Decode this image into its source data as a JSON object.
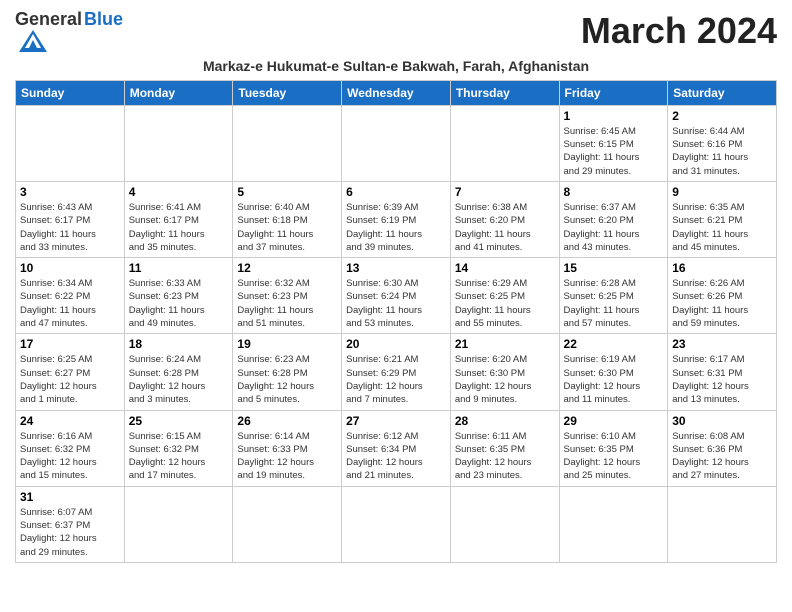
{
  "header": {
    "logo_general": "General",
    "logo_blue": "Blue",
    "month_title": "March 2024",
    "subtitle": "Markaz-e Hukumat-e Sultan-e Bakwah, Farah, Afghanistan"
  },
  "weekdays": [
    "Sunday",
    "Monday",
    "Tuesday",
    "Wednesday",
    "Thursday",
    "Friday",
    "Saturday"
  ],
  "weeks": [
    [
      {
        "day": "",
        "info": ""
      },
      {
        "day": "",
        "info": ""
      },
      {
        "day": "",
        "info": ""
      },
      {
        "day": "",
        "info": ""
      },
      {
        "day": "",
        "info": ""
      },
      {
        "day": "1",
        "info": "Sunrise: 6:45 AM\nSunset: 6:15 PM\nDaylight: 11 hours\nand 29 minutes."
      },
      {
        "day": "2",
        "info": "Sunrise: 6:44 AM\nSunset: 6:16 PM\nDaylight: 11 hours\nand 31 minutes."
      }
    ],
    [
      {
        "day": "3",
        "info": "Sunrise: 6:43 AM\nSunset: 6:17 PM\nDaylight: 11 hours\nand 33 minutes."
      },
      {
        "day": "4",
        "info": "Sunrise: 6:41 AM\nSunset: 6:17 PM\nDaylight: 11 hours\nand 35 minutes."
      },
      {
        "day": "5",
        "info": "Sunrise: 6:40 AM\nSunset: 6:18 PM\nDaylight: 11 hours\nand 37 minutes."
      },
      {
        "day": "6",
        "info": "Sunrise: 6:39 AM\nSunset: 6:19 PM\nDaylight: 11 hours\nand 39 minutes."
      },
      {
        "day": "7",
        "info": "Sunrise: 6:38 AM\nSunset: 6:20 PM\nDaylight: 11 hours\nand 41 minutes."
      },
      {
        "day": "8",
        "info": "Sunrise: 6:37 AM\nSunset: 6:20 PM\nDaylight: 11 hours\nand 43 minutes."
      },
      {
        "day": "9",
        "info": "Sunrise: 6:35 AM\nSunset: 6:21 PM\nDaylight: 11 hours\nand 45 minutes."
      }
    ],
    [
      {
        "day": "10",
        "info": "Sunrise: 6:34 AM\nSunset: 6:22 PM\nDaylight: 11 hours\nand 47 minutes."
      },
      {
        "day": "11",
        "info": "Sunrise: 6:33 AM\nSunset: 6:23 PM\nDaylight: 11 hours\nand 49 minutes."
      },
      {
        "day": "12",
        "info": "Sunrise: 6:32 AM\nSunset: 6:23 PM\nDaylight: 11 hours\nand 51 minutes."
      },
      {
        "day": "13",
        "info": "Sunrise: 6:30 AM\nSunset: 6:24 PM\nDaylight: 11 hours\nand 53 minutes."
      },
      {
        "day": "14",
        "info": "Sunrise: 6:29 AM\nSunset: 6:25 PM\nDaylight: 11 hours\nand 55 minutes."
      },
      {
        "day": "15",
        "info": "Sunrise: 6:28 AM\nSunset: 6:25 PM\nDaylight: 11 hours\nand 57 minutes."
      },
      {
        "day": "16",
        "info": "Sunrise: 6:26 AM\nSunset: 6:26 PM\nDaylight: 11 hours\nand 59 minutes."
      }
    ],
    [
      {
        "day": "17",
        "info": "Sunrise: 6:25 AM\nSunset: 6:27 PM\nDaylight: 12 hours\nand 1 minute."
      },
      {
        "day": "18",
        "info": "Sunrise: 6:24 AM\nSunset: 6:28 PM\nDaylight: 12 hours\nand 3 minutes."
      },
      {
        "day": "19",
        "info": "Sunrise: 6:23 AM\nSunset: 6:28 PM\nDaylight: 12 hours\nand 5 minutes."
      },
      {
        "day": "20",
        "info": "Sunrise: 6:21 AM\nSunset: 6:29 PM\nDaylight: 12 hours\nand 7 minutes."
      },
      {
        "day": "21",
        "info": "Sunrise: 6:20 AM\nSunset: 6:30 PM\nDaylight: 12 hours\nand 9 minutes."
      },
      {
        "day": "22",
        "info": "Sunrise: 6:19 AM\nSunset: 6:30 PM\nDaylight: 12 hours\nand 11 minutes."
      },
      {
        "day": "23",
        "info": "Sunrise: 6:17 AM\nSunset: 6:31 PM\nDaylight: 12 hours\nand 13 minutes."
      }
    ],
    [
      {
        "day": "24",
        "info": "Sunrise: 6:16 AM\nSunset: 6:32 PM\nDaylight: 12 hours\nand 15 minutes."
      },
      {
        "day": "25",
        "info": "Sunrise: 6:15 AM\nSunset: 6:32 PM\nDaylight: 12 hours\nand 17 minutes."
      },
      {
        "day": "26",
        "info": "Sunrise: 6:14 AM\nSunset: 6:33 PM\nDaylight: 12 hours\nand 19 minutes."
      },
      {
        "day": "27",
        "info": "Sunrise: 6:12 AM\nSunset: 6:34 PM\nDaylight: 12 hours\nand 21 minutes."
      },
      {
        "day": "28",
        "info": "Sunrise: 6:11 AM\nSunset: 6:35 PM\nDaylight: 12 hours\nand 23 minutes."
      },
      {
        "day": "29",
        "info": "Sunrise: 6:10 AM\nSunset: 6:35 PM\nDaylight: 12 hours\nand 25 minutes."
      },
      {
        "day": "30",
        "info": "Sunrise: 6:08 AM\nSunset: 6:36 PM\nDaylight: 12 hours\nand 27 minutes."
      }
    ],
    [
      {
        "day": "31",
        "info": "Sunrise: 6:07 AM\nSunset: 6:37 PM\nDaylight: 12 hours\nand 29 minutes."
      },
      {
        "day": "",
        "info": ""
      },
      {
        "day": "",
        "info": ""
      },
      {
        "day": "",
        "info": ""
      },
      {
        "day": "",
        "info": ""
      },
      {
        "day": "",
        "info": ""
      },
      {
        "day": "",
        "info": ""
      }
    ]
  ]
}
